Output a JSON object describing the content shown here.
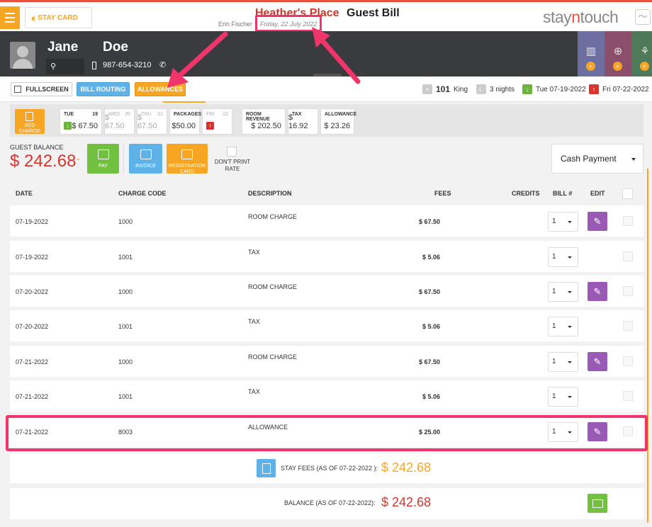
{
  "topbar": {
    "stay_card_label": "STAY CARD",
    "hotel_name": "Heather's Place",
    "bill_title": "Guest Bill",
    "user_name": "Erin Fischer",
    "business_date": "Friday, 22 July 2022",
    "logo_text_a": "stay",
    "logo_text_b": "n",
    "logo_text_c": "touch"
  },
  "guest": {
    "first_name": "Jane",
    "last_name": "Doe",
    "phone": "987-654-3210"
  },
  "toolbar": {
    "fullscreen_label": "FULLSCREEN",
    "bill_routing_label": "BILL ROUTING",
    "allowances_label": "ALLOWANCES",
    "room_number": "101",
    "room_type": "King",
    "nights": "3 nights",
    "arrival": "Tue 07-19-2022",
    "departure": "Fri 07-22-2022"
  },
  "calendar": {
    "add_charge_label": "ADD CHARGE",
    "days": [
      {
        "name": "TUE",
        "date": "19",
        "value": "$ 67.50"
      },
      {
        "name": "WED",
        "date": "20",
        "value": "$ 67.50"
      },
      {
        "name": "THU",
        "date": "21",
        "value": "$ 67.50"
      },
      {
        "name": "FRI",
        "date": "22"
      }
    ],
    "packages_label": "PACKAGES",
    "packages_value": "$50.00",
    "room_revenue_label": "ROOM REVENUE",
    "room_revenue_value": "$ 202.50",
    "tax_label": "TAX",
    "tax_value": "$ 16.92",
    "allowance_label": "ALLOWANCE",
    "allowance_value": "$ 23.26"
  },
  "balance": {
    "label": "GUEST BALANCE",
    "value": "$ 242.68",
    "pay_label": "PAY",
    "invoice_label": "INVOICE",
    "registration_label": "REGISTRATION CARD",
    "dont_print_label": "DON'T PRINT RATE",
    "payment_method": "Cash Payment"
  },
  "table": {
    "headers": {
      "date": "DATE",
      "code": "CHARGE CODE",
      "desc": "DESCRIPTION",
      "fees": "FEES",
      "credits": "CREDITS",
      "bill": "BILL #",
      "edit": "EDIT"
    },
    "rows": [
      {
        "date": "07-19-2022",
        "code": "1000",
        "desc": "ROOM CHARGE",
        "fee": "$ 67.50",
        "bill": "1",
        "editable": true
      },
      {
        "date": "07-19-2022",
        "code": "1001",
        "desc": "TAX",
        "fee": "$ 5.06",
        "bill": "1",
        "editable": false
      },
      {
        "date": "07-20-2022",
        "code": "1000",
        "desc": "ROOM CHARGE",
        "fee": "$ 67.50",
        "bill": "1",
        "editable": true
      },
      {
        "date": "07-20-2022",
        "code": "1001",
        "desc": "TAX",
        "fee": "$ 5.06",
        "bill": "1",
        "editable": false
      },
      {
        "date": "07-21-2022",
        "code": "1000",
        "desc": "ROOM CHARGE",
        "fee": "$ 67.50",
        "bill": "1",
        "editable": true
      },
      {
        "date": "07-21-2022",
        "code": "1001",
        "desc": "TAX",
        "fee": "$ 5.06",
        "bill": "1",
        "editable": false
      },
      {
        "date": "07-21-2022",
        "code": "8003",
        "desc": "ALLOWANCE",
        "fee": "$ 25.00",
        "bill": "1",
        "editable": true
      }
    ]
  },
  "totals": {
    "stay_fees_label": "STAY FEES (AS OF 07-22-2022 ):",
    "stay_fees_value": "$ 242.68",
    "balance_label": "BALANCE (AS OF 07-22-2022):",
    "balance_value": "$ 242.68"
  },
  "colors": {
    "accent": "#f6a623",
    "danger": "#d9332e",
    "highlight": "#f0356b",
    "edit": "#9b59b6"
  }
}
